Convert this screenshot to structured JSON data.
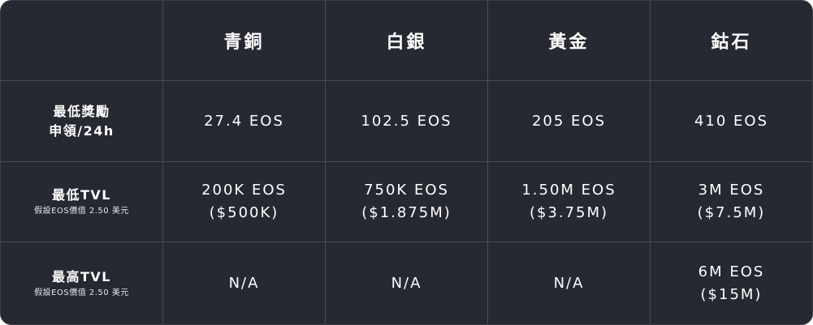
{
  "header": {
    "empty": "",
    "tiers": [
      "青銅",
      "白銀",
      "黃金",
      "鈷石"
    ]
  },
  "rows": [
    {
      "label_line1": "最低獎勵",
      "label_line2": "申領/24h",
      "values": [
        {
          "line1": "27.4 EOS",
          "line2": ""
        },
        {
          "line1": "102.5 EOS",
          "line2": ""
        },
        {
          "line1": "205 EOS",
          "line2": ""
        },
        {
          "line1": "410 EOS",
          "line2": ""
        }
      ]
    },
    {
      "label_main": "最低TVL",
      "label_note": "假設EOS價值 2.50 美元",
      "values": [
        {
          "line1": "200K EOS",
          "line2": "($500K)"
        },
        {
          "line1": "750K EOS",
          "line2": "($1.875M)"
        },
        {
          "line1": "1.50M EOS",
          "line2": "($3.75M)"
        },
        {
          "line1": "3M EOS",
          "line2": "($7.5M)"
        }
      ]
    },
    {
      "label_main": "最高TVL",
      "label_note": "假設EOS價值 2.50 美元",
      "values": [
        {
          "line1": "N/A",
          "line2": ""
        },
        {
          "line1": "N/A",
          "line2": ""
        },
        {
          "line1": "N/A",
          "line2": ""
        },
        {
          "line1": "6M EOS",
          "line2": "($15M)"
        }
      ]
    }
  ],
  "colors": {
    "background": "#262832",
    "grid_line": "#4a4c57",
    "text": "#ffffff"
  }
}
